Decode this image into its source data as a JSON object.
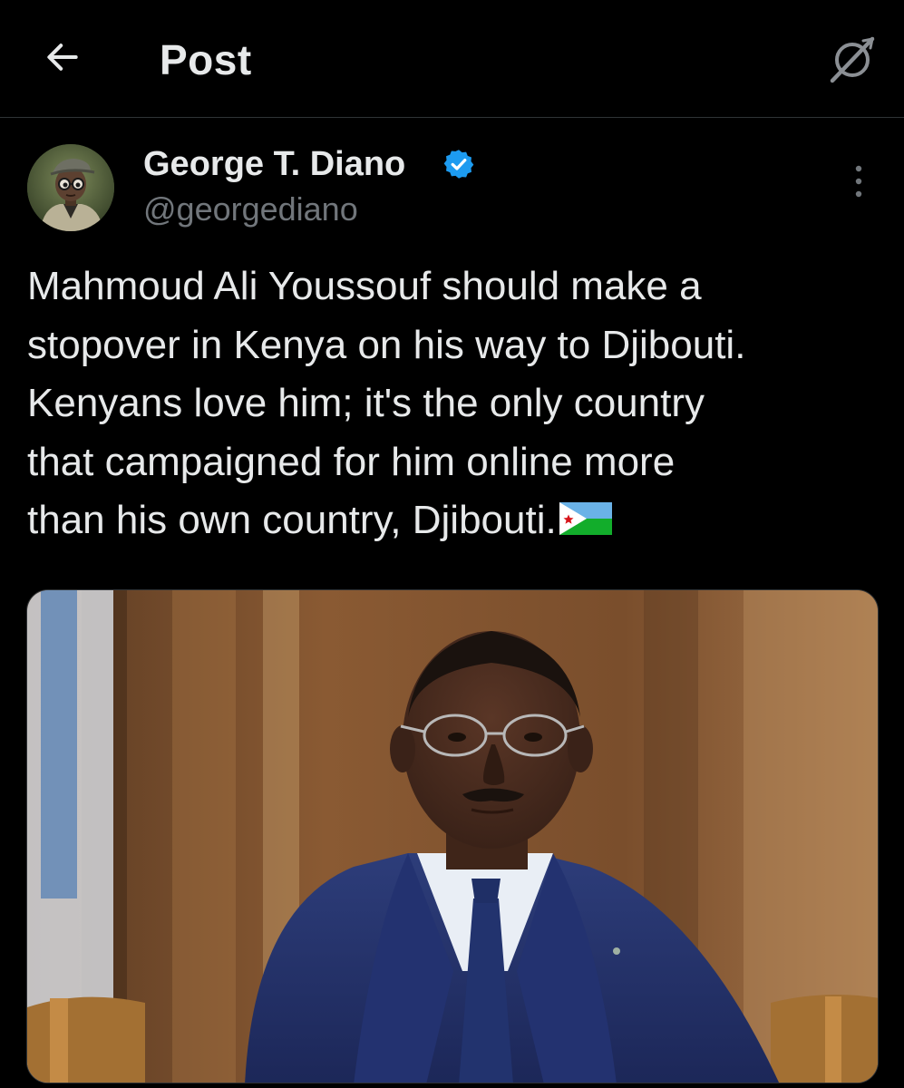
{
  "header": {
    "title": "Post",
    "back_icon": "arrow-left-icon",
    "grok_icon": "grok-slash-icon"
  },
  "author": {
    "name": "George T. Diano",
    "handle": "@georgediano",
    "verified": true,
    "verified_color": "#1d9bf0"
  },
  "post": {
    "text": "Mahmoud Ali Youssouf should make a\nstopover in Kenya on his way to Djibouti.\nKenyans love him; it's the only country\nthat campaigned for him online more\nthan his own country, Djibouti.",
    "emoji": "flag-djibouti"
  },
  "colors": {
    "background": "#000000",
    "text": "#e7e9ea",
    "secondary_text": "#71767b",
    "divider": "#2f3336"
  }
}
